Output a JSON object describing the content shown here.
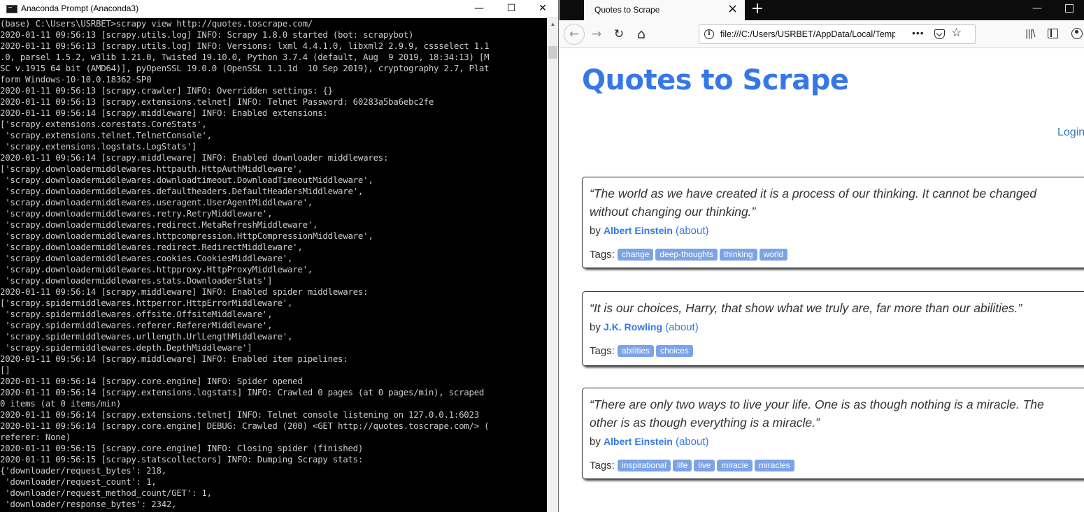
{
  "terminal": {
    "title": "Anaconda Prompt (Anaconda3)",
    "controls": {
      "minimize": "—",
      "maximize": "☐",
      "close": "✕"
    },
    "lines": [
      "(base) C:\\Users\\USRBET>scrapy view http://quotes.toscrape.com/",
      "2020-01-11 09:56:13 [scrapy.utils.log] INFO: Scrapy 1.8.0 started (bot: scrapybot)",
      "2020-01-11 09:56:13 [scrapy.utils.log] INFO: Versions: lxml 4.4.1.0, libxml2 2.9.9, cssselect 1.1",
      ".0, parsel 1.5.2, w3lib 1.21.0, Twisted 19.10.0, Python 3.7.4 (default, Aug  9 2019, 18:34:13) [M",
      "SC v.1915 64 bit (AMD64)], pyOpenSSL 19.0.0 (OpenSSL 1.1.1d  10 Sep 2019), cryptography 2.7, Plat",
      "form Windows-10-10.0.18362-SP0",
      "2020-01-11 09:56:13 [scrapy.crawler] INFO: Overridden settings: {}",
      "2020-01-11 09:56:13 [scrapy.extensions.telnet] INFO: Telnet Password: 60283a5ba6ebc2fe",
      "2020-01-11 09:56:14 [scrapy.middleware] INFO: Enabled extensions:",
      "['scrapy.extensions.corestats.CoreStats',",
      " 'scrapy.extensions.telnet.TelnetConsole',",
      " 'scrapy.extensions.logstats.LogStats']",
      "2020-01-11 09:56:14 [scrapy.middleware] INFO: Enabled downloader middlewares:",
      "['scrapy.downloadermiddlewares.httpauth.HttpAuthMiddleware',",
      " 'scrapy.downloadermiddlewares.downloadtimeout.DownloadTimeoutMiddleware',",
      " 'scrapy.downloadermiddlewares.defaultheaders.DefaultHeadersMiddleware',",
      " 'scrapy.downloadermiddlewares.useragent.UserAgentMiddleware',",
      " 'scrapy.downloadermiddlewares.retry.RetryMiddleware',",
      " 'scrapy.downloadermiddlewares.redirect.MetaRefreshMiddleware',",
      " 'scrapy.downloadermiddlewares.httpcompression.HttpCompressionMiddleware',",
      " 'scrapy.downloadermiddlewares.redirect.RedirectMiddleware',",
      " 'scrapy.downloadermiddlewares.cookies.CookiesMiddleware',",
      " 'scrapy.downloadermiddlewares.httpproxy.HttpProxyMiddleware',",
      " 'scrapy.downloadermiddlewares.stats.DownloaderStats']",
      "2020-01-11 09:56:14 [scrapy.middleware] INFO: Enabled spider middlewares:",
      "['scrapy.spidermiddlewares.httperror.HttpErrorMiddleware',",
      " 'scrapy.spidermiddlewares.offsite.OffsiteMiddleware',",
      " 'scrapy.spidermiddlewares.referer.RefererMiddleware',",
      " 'scrapy.spidermiddlewares.urllength.UrlLengthMiddleware',",
      " 'scrapy.spidermiddlewares.depth.DepthMiddleware']",
      "2020-01-11 09:56:14 [scrapy.middleware] INFO: Enabled item pipelines:",
      "[]",
      "2020-01-11 09:56:14 [scrapy.core.engine] INFO: Spider opened",
      "2020-01-11 09:56:14 [scrapy.extensions.logstats] INFO: Crawled 0 pages (at 0 pages/min), scraped",
      "0 items (at 0 items/min)",
      "2020-01-11 09:56:14 [scrapy.extensions.telnet] INFO: Telnet console listening on 127.0.0.1:6023",
      "2020-01-11 09:56:14 [scrapy.core.engine] DEBUG: Crawled (200) <GET http://quotes.toscrape.com/> (",
      "referer: None)",
      "2020-01-11 09:56:15 [scrapy.core.engine] INFO: Closing spider (finished)",
      "2020-01-11 09:56:15 [scrapy.statscollectors] INFO: Dumping Scrapy stats:",
      "{'downloader/request_bytes': 218,",
      " 'downloader/request_count': 1,",
      " 'downloader/request_method_count/GET': 1,",
      " 'downloader/response_bytes': 2342,"
    ],
    "colors": {
      "background": "#000000",
      "text": "#cccccc"
    }
  },
  "browser": {
    "tab": {
      "title": "Quotes to Scrape",
      "close_icon": "close-icon"
    },
    "new_tab_label": "+",
    "window_controls": {
      "minimize": "—"
    },
    "nav": {
      "back": "←",
      "forward": "→",
      "reload": "↻",
      "home": "⌂"
    },
    "url": "file:///C:/Users/USRBET/AppData/Local/Temp/",
    "url_actions": {
      "more": "•••",
      "bookmark": "☆"
    },
    "toolbar": {
      "library": "|||\\"
    },
    "page": {
      "site_title": "Quotes to Scrape",
      "login": "Login",
      "by_label": "by",
      "about_label": "(about)",
      "tags_label": "Tags:",
      "quotes": [
        {
          "text": "“The world as we have created it is a process of our thinking. It cannot be changed without changing our thinking.”",
          "author": "Albert Einstein",
          "tags": [
            "change",
            "deep-thoughts",
            "thinking",
            "world"
          ]
        },
        {
          "text": "“It is our choices, Harry, that show what we truly are, far more than our abilities.”",
          "author": "J.K. Rowling",
          "tags": [
            "abilities",
            "choices"
          ]
        },
        {
          "text": "“There are only two ways to live your life. One is as though nothing is a miracle. The other is as though everything is a miracle.”",
          "author": "Albert Einstein",
          "tags": [
            "inspirational",
            "life",
            "live",
            "miracle",
            "miracles"
          ]
        }
      ]
    },
    "colors": {
      "title_blue": "#3677e8",
      "tag_bg": "#7ca3e6",
      "tab_strip": "#0c0c0d"
    }
  }
}
